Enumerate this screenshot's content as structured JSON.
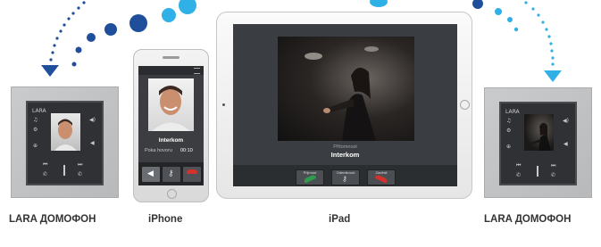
{
  "captions": {
    "lara_left": "LARA ДОМОФОН",
    "iphone": "iPhone",
    "ipad": "iPad",
    "lara_right": "LARA ДОМОФОН"
  },
  "iphone_screen": {
    "title": "Interkom",
    "status_label": "Poka hovoru",
    "timer": "00:10"
  },
  "ipad_screen": {
    "caption": "Interkom",
    "subcaption": "Přítomnost",
    "buttons": [
      "Přijmout",
      "Odemknout",
      "Zavěsit"
    ]
  },
  "colors": {
    "accent_dark_blue": "#1f4f9a",
    "accent_light_blue": "#2fb0e6",
    "accept_green": "#2e9b4d",
    "reject_red": "#d2312d"
  },
  "icons": [
    "arrow-down-icon",
    "speaker-icon",
    "key-icon",
    "phone-hangup-icon",
    "phone-accept-icon",
    "volume-icon"
  ]
}
